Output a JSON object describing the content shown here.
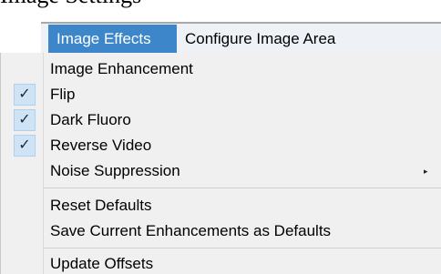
{
  "window": {
    "partial_title": "Image Settings"
  },
  "menubar": {
    "items": [
      {
        "label": "Image Effects",
        "active": true
      },
      {
        "label": "Configure Image Area",
        "active": false
      }
    ]
  },
  "menu": {
    "check_glyph": "✓",
    "submenu_glyph": "▸",
    "items": [
      {
        "label": "Image Enhancement",
        "checked": false,
        "submenu": false
      },
      {
        "label": "Flip",
        "checked": true,
        "submenu": false
      },
      {
        "label": "Dark Fluoro",
        "checked": true,
        "submenu": false
      },
      {
        "label": "Reverse Video",
        "checked": true,
        "submenu": false
      },
      {
        "label": "Noise Suppression",
        "checked": false,
        "submenu": true
      },
      {
        "label": "Reset Defaults",
        "checked": false,
        "submenu": false
      },
      {
        "label": "Save Current Enhancements as Defaults",
        "checked": false,
        "submenu": false
      },
      {
        "label": "Update Offsets",
        "checked": false,
        "submenu": false
      }
    ]
  },
  "colors": {
    "active_menu_bg": "#3d86c9",
    "menubar_bg": "#eef2f7",
    "dropdown_bg": "#f0f0f0",
    "check_bg": "#cfe3f7"
  }
}
